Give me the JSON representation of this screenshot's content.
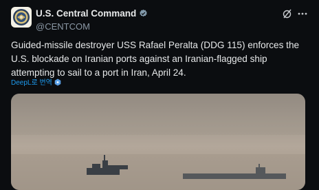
{
  "account": {
    "display_name": "U.S. Central Command",
    "handle": "@CENTCOM"
  },
  "tweet": {
    "text": "Guided-missile destroyer USS Rafael Peralta (DDG 115) enforces the U.S. blockade on Iranian ports against an Iranian-flagged ship attempting to sail to a port in Iran, April 24.",
    "translate_label": "DeepL로 번역"
  },
  "icons": {
    "verified": "verified-badge-icon",
    "grok": "grok-icon",
    "more": "more-options-icon",
    "translate": "deepl-icon"
  },
  "colors": {
    "background": "#0b0d10",
    "link": "#1d9bf0",
    "secondary_text": "#8b98a5"
  }
}
